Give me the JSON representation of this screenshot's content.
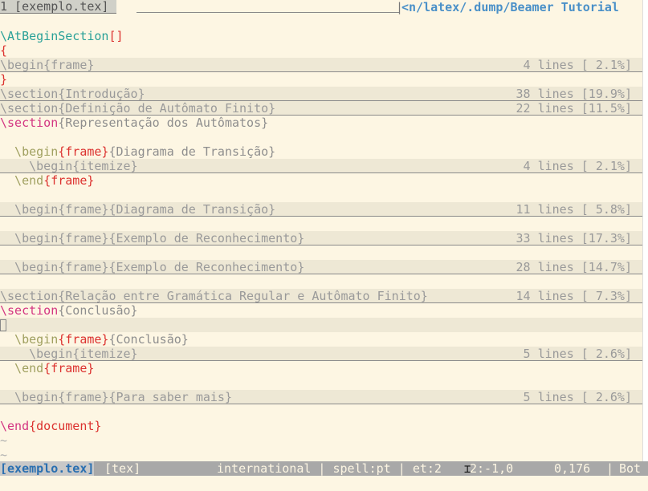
{
  "tabline": {
    "tab1": " 1 [exemplo.tex] ",
    "sep": "|",
    "path": "<n/latex/.dump/Beamer Tutorial"
  },
  "lines": {
    "l1_cmd": "\\AtBeginSection",
    "l1_br": "[]",
    "l2": "{",
    "l3_text": "\\begin{frame}",
    "l3_info": "4 lines [ 2.1%]",
    "l4": "}",
    "l5_text": "\\section{Introdução}",
    "l5_info": "38 lines [19.9%]",
    "l6_text": "\\section{Definição de Autômato Finito}",
    "l6_info": "22 lines [11.5%]",
    "l7_cmd": "\\section",
    "l7_arg": "{Representação dos Autômatos}",
    "l8_cmd": "  \\begin",
    "l8_env": "{frame}",
    "l8_arg": "{Diagrama de Transição}",
    "l9_text": "    \\begin{itemize}",
    "l9_info": "4 lines [ 2.1%]",
    "l10_cmd": "  \\end",
    "l10_env": "{frame}",
    "l11_text": "  \\begin{frame}{Diagrama de Transição}",
    "l11_info": "11 lines [ 5.8%]",
    "l12_text": "  \\begin{frame}{Exemplo de Reconhecimento}",
    "l12_info": "33 lines [17.3%]",
    "l13_text": "  \\begin{frame}{Exemplo de Reconhecimento}",
    "l13_info": "28 lines [14.7%]",
    "l14_text": "\\section{Relação entre Gramática Regular e Autômato Finito}",
    "l14_info": "14 lines [ 7.3%]",
    "l15_cmd": "\\section",
    "l15_arg": "{Conclusão}",
    "l16_cmd": "  \\begin",
    "l16_env": "{frame}",
    "l16_arg": "{Conclusão}",
    "l17_text": "    \\begin{itemize}",
    "l17_info": "5 lines [ 2.6%]",
    "l18_cmd": "  \\end",
    "l18_env": "{frame}",
    "l19_text": "  \\begin{frame}{Para saber mais}",
    "l19_info": "5 lines [ 2.6%]",
    "l20_cmd": "\\end",
    "l20_env": "{document}",
    "tilde": "~"
  },
  "status": {
    "file": "[exemplo.tex]",
    "filetype": "[tex]",
    "keymap": "international | spell:pt | et:2",
    "cursor_tail": "2:-1,0",
    "position": "0,176",
    "sep": "|",
    "scroll": "Bot"
  },
  "colors": {
    "background": "#fdf6e3",
    "fold_background": "#eee8d5",
    "keyword": "#d33682",
    "path_blue": "#4a90c8",
    "status_bg": "#a8a8a8"
  }
}
